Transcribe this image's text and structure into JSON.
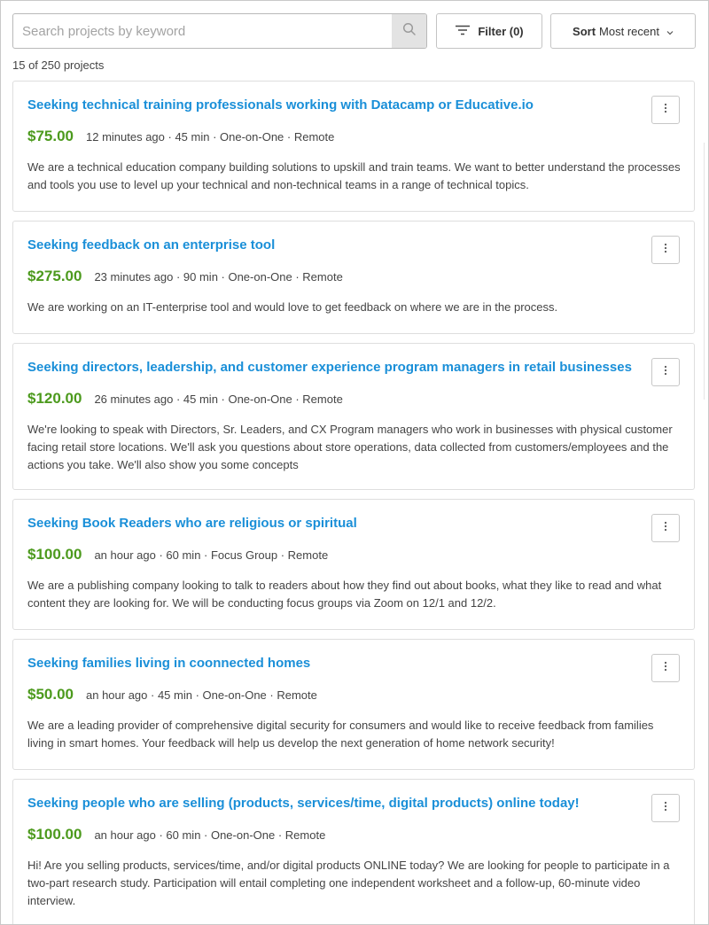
{
  "search": {
    "placeholder": "Search projects by keyword",
    "value": "",
    "icon": "search-icon"
  },
  "toolbar": {
    "filter_label": "Filter (0)",
    "filter_icon": "filter-lines-icon",
    "sort_prefix": "Sort",
    "sort_value": "Most recent",
    "sort_icon": "chevron-down-icon"
  },
  "results": {
    "count_text": "15 of 250 projects"
  },
  "colors": {
    "title": "#1a8fd8",
    "price": "#4c9a1d",
    "text": "#444444",
    "border": "#dedede"
  },
  "projects": [
    {
      "title": "Seeking technical training professionals working with Datacamp or Educative.io",
      "price": "$75.00",
      "details": "12 minutes ago · 45 min · One-on-One · Remote",
      "description": "We are a technical education company building solutions to upskill and train teams. We want to better understand the processes and tools you use to level up your technical and non-technical teams in a range of technical topics."
    },
    {
      "title": "Seeking feedback on an enterprise tool",
      "price": "$275.00",
      "details": "23 minutes ago · 90 min · One-on-One · Remote",
      "description": "We are working on an IT-enterprise tool and would love to get feedback on where we are in the process."
    },
    {
      "title": "Seeking directors, leadership, and customer experience program managers in retail businesses",
      "price": "$120.00",
      "details": "26 minutes ago · 45 min · One-on-One · Remote",
      "description": "We're looking to speak with Directors, Sr. Leaders, and CX Program managers who work in businesses with physical customer facing retail store locations. We'll ask you questions about store operations, data collected from customers/employees and the actions you take. We'll also show you some concepts"
    },
    {
      "title": "Seeking Book Readers who are religious or spiritual",
      "price": "$100.00",
      "details": "an hour ago · 60 min · Focus Group · Remote",
      "description": "We are a publishing company looking to talk to readers about how they find out about books, what they like to read and what content they are looking for. We will be conducting focus groups via Zoom on 12/1 and 12/2."
    },
    {
      "title": "Seeking families living in coonnected homes",
      "price": "$50.00",
      "details": "an hour ago · 45 min · One-on-One · Remote",
      "description": "We are a leading provider of comprehensive digital security for consumers and would like to receive feedback from families living in smart homes. Your feedback will help us develop the next generation of home network security!"
    },
    {
      "title": "Seeking people who are selling (products, services/time, digital products) online today!",
      "price": "$100.00",
      "details": "an hour ago · 60 min · One-on-One · Remote",
      "description": "Hi! Are you selling products, services/time, and/or digital products ONLINE today? We are looking for people to participate in a two-part research study. Participation will entail completing one independent worksheet and a follow-up, 60-minute video interview."
    }
  ]
}
